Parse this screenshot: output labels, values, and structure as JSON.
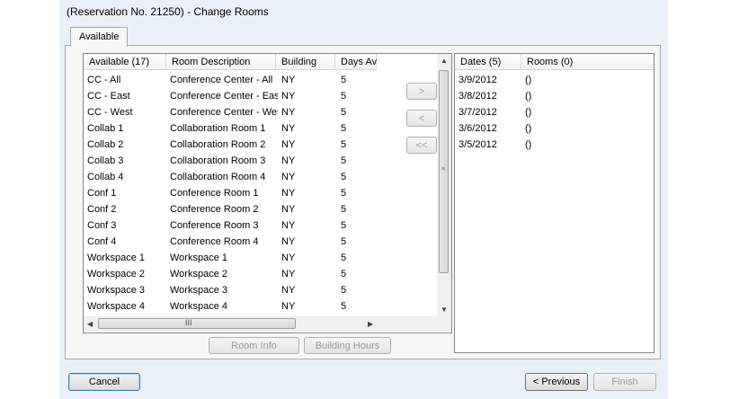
{
  "window": {
    "title": "(Reservation No. 21250) - Change Rooms"
  },
  "tab": {
    "label": "Available"
  },
  "available": {
    "columns": [
      "Available (17)",
      "Room Description",
      "Building",
      "Days Av"
    ],
    "rows": [
      [
        "CC - All",
        "Conference Center - All",
        "NY",
        "5"
      ],
      [
        "CC - East",
        "Conference Center - East",
        "NY",
        "5"
      ],
      [
        "CC - West",
        "Conference Center - West",
        "NY",
        "5"
      ],
      [
        "Collab 1",
        "Collaboration Room 1",
        "NY",
        "5"
      ],
      [
        "Collab 2",
        "Collaboration Room 2",
        "NY",
        "5"
      ],
      [
        "Collab 3",
        "Collaboration Room 3",
        "NY",
        "5"
      ],
      [
        "Collab 4",
        "Collaboration Room 4",
        "NY",
        "5"
      ],
      [
        "Conf 1",
        "Conference Room 1",
        "NY",
        "5"
      ],
      [
        "Conf 2",
        "Conference Room 2",
        "NY",
        "5"
      ],
      [
        "Conf 3",
        "Conference Room 3",
        "NY",
        "5"
      ],
      [
        "Conf 4",
        "Conference Room 4",
        "NY",
        "5"
      ],
      [
        "Workspace 1",
        "Workspace 1",
        "NY",
        "5"
      ],
      [
        "Workspace 2",
        "Workspace 2",
        "NY",
        "5"
      ],
      [
        "Workspace 3",
        "Workspace 3",
        "NY",
        "5"
      ],
      [
        "Workspace 4",
        "Workspace 4",
        "NY",
        "5"
      ]
    ],
    "hscroll_thumb_label": "III"
  },
  "transfer": {
    "add": ">",
    "remove": "<",
    "remove_all": "<<"
  },
  "dates": {
    "columns": [
      "Dates (5)",
      "Rooms (0)"
    ],
    "rows": [
      [
        "3/9/2012",
        "()"
      ],
      [
        "3/8/2012",
        "()"
      ],
      [
        "3/7/2012",
        "()"
      ],
      [
        "3/6/2012",
        "()"
      ],
      [
        "3/5/2012",
        "()"
      ]
    ]
  },
  "buttons": {
    "room_info": "Room Info",
    "building_hours": "Building Hours",
    "cancel": "Cancel",
    "previous": "< Previous",
    "finish": "Finish"
  }
}
